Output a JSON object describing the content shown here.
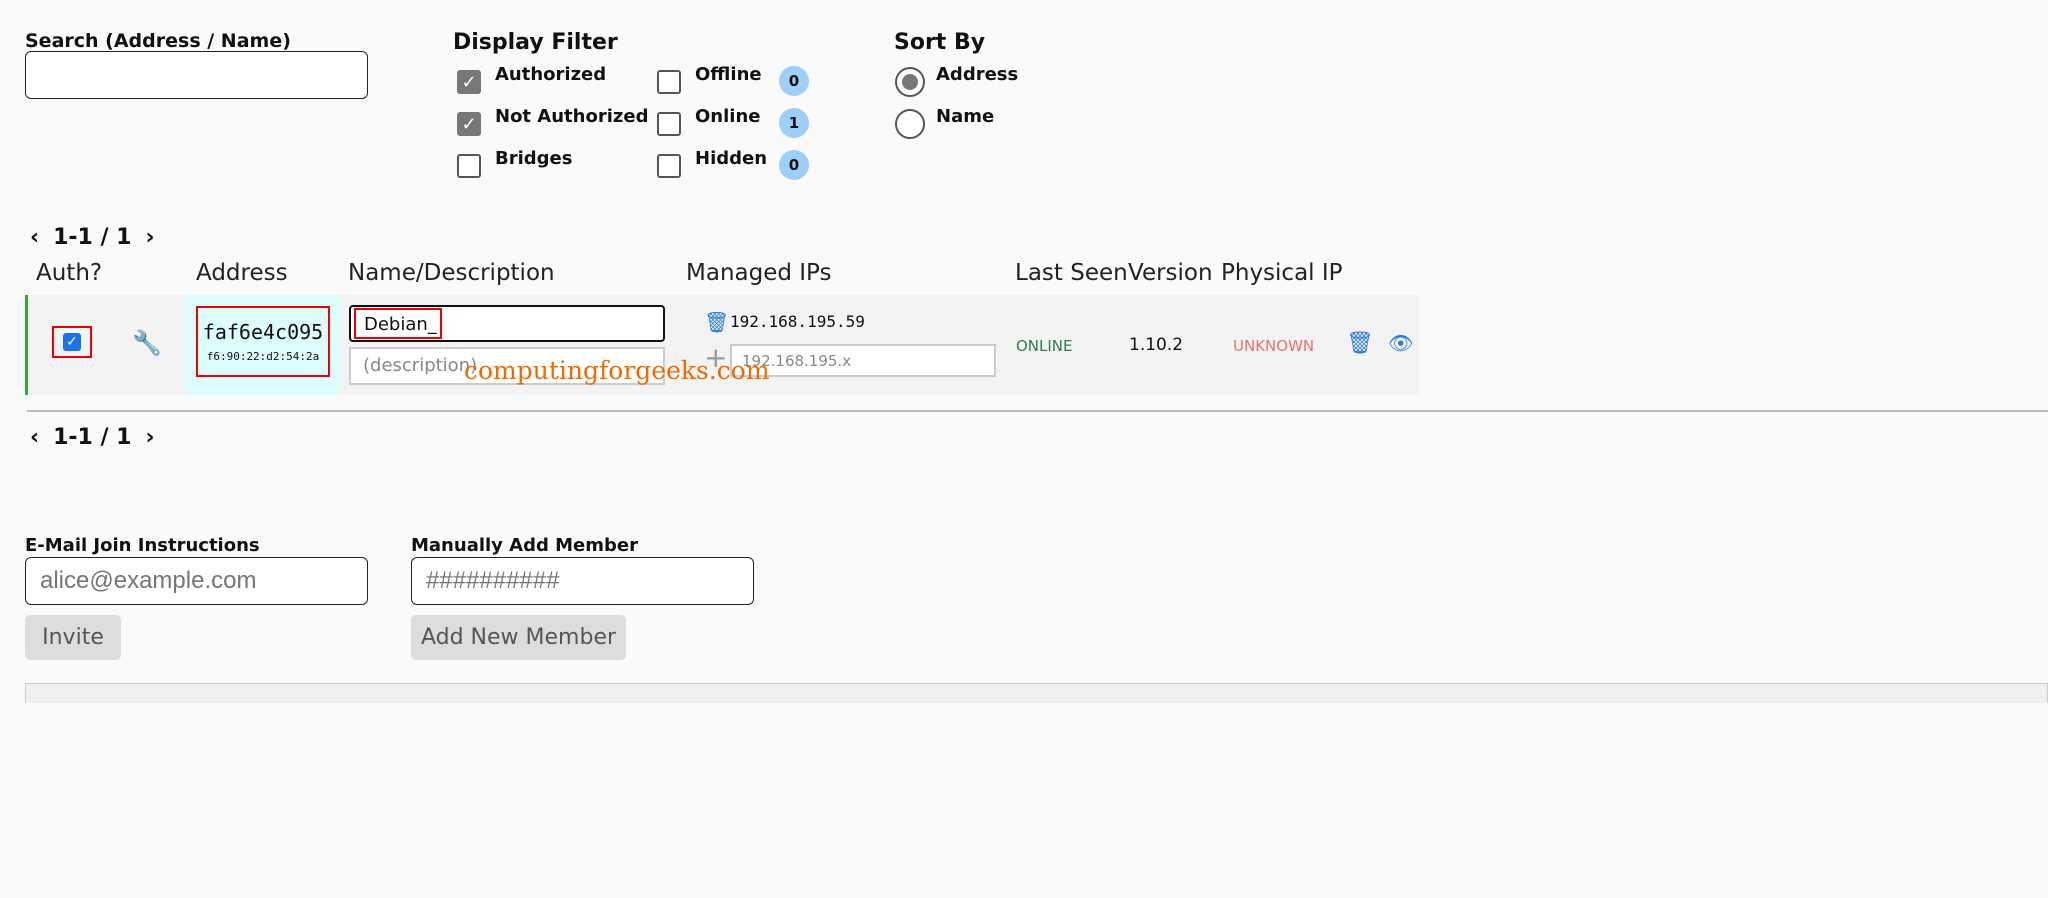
{
  "search": {
    "label": "Search (Address / Name)",
    "value": ""
  },
  "display_filter": {
    "title": "Display Filter",
    "items": [
      {
        "label": "Authorized",
        "checked": true
      },
      {
        "label": "Not Authorized",
        "checked": true
      },
      {
        "label": "Bridges",
        "checked": false
      },
      {
        "label": "Offline",
        "checked": false,
        "count": "0"
      },
      {
        "label": "Online",
        "checked": false,
        "count": "1"
      },
      {
        "label": "Hidden",
        "checked": false,
        "count": "0"
      }
    ]
  },
  "sort": {
    "title": "Sort By",
    "options": [
      {
        "label": "Address",
        "selected": true
      },
      {
        "label": "Name",
        "selected": false
      }
    ]
  },
  "pagination": {
    "range": "1-1 / 1"
  },
  "columns": [
    "Auth?",
    "Address",
    "Name/Description",
    "Managed IPs",
    "Last Seen",
    "Version",
    "Physical IP"
  ],
  "member": {
    "authorized": true,
    "address": "faf6e4c095",
    "mac": "f6:90:22:d2:54:2a",
    "name": "Debian_",
    "description_placeholder": "(description)",
    "ip": "192.168.195.59",
    "ip_placeholder": "192.168.195.x",
    "last_seen": "ONLINE",
    "version": "1.10.2",
    "physical_ip": "UNKNOWN"
  },
  "watermark": "computingforgeeks.com",
  "invite": {
    "label": "E-Mail Join Instructions",
    "placeholder": "alice@example.com",
    "button": "Invite"
  },
  "add_member": {
    "label": "Manually Add Member",
    "placeholder": "##########",
    "button": "Add New Member"
  },
  "colors": {
    "online": "#2e7d4a",
    "unknown": "#e57373",
    "accent": "#2979d9"
  }
}
